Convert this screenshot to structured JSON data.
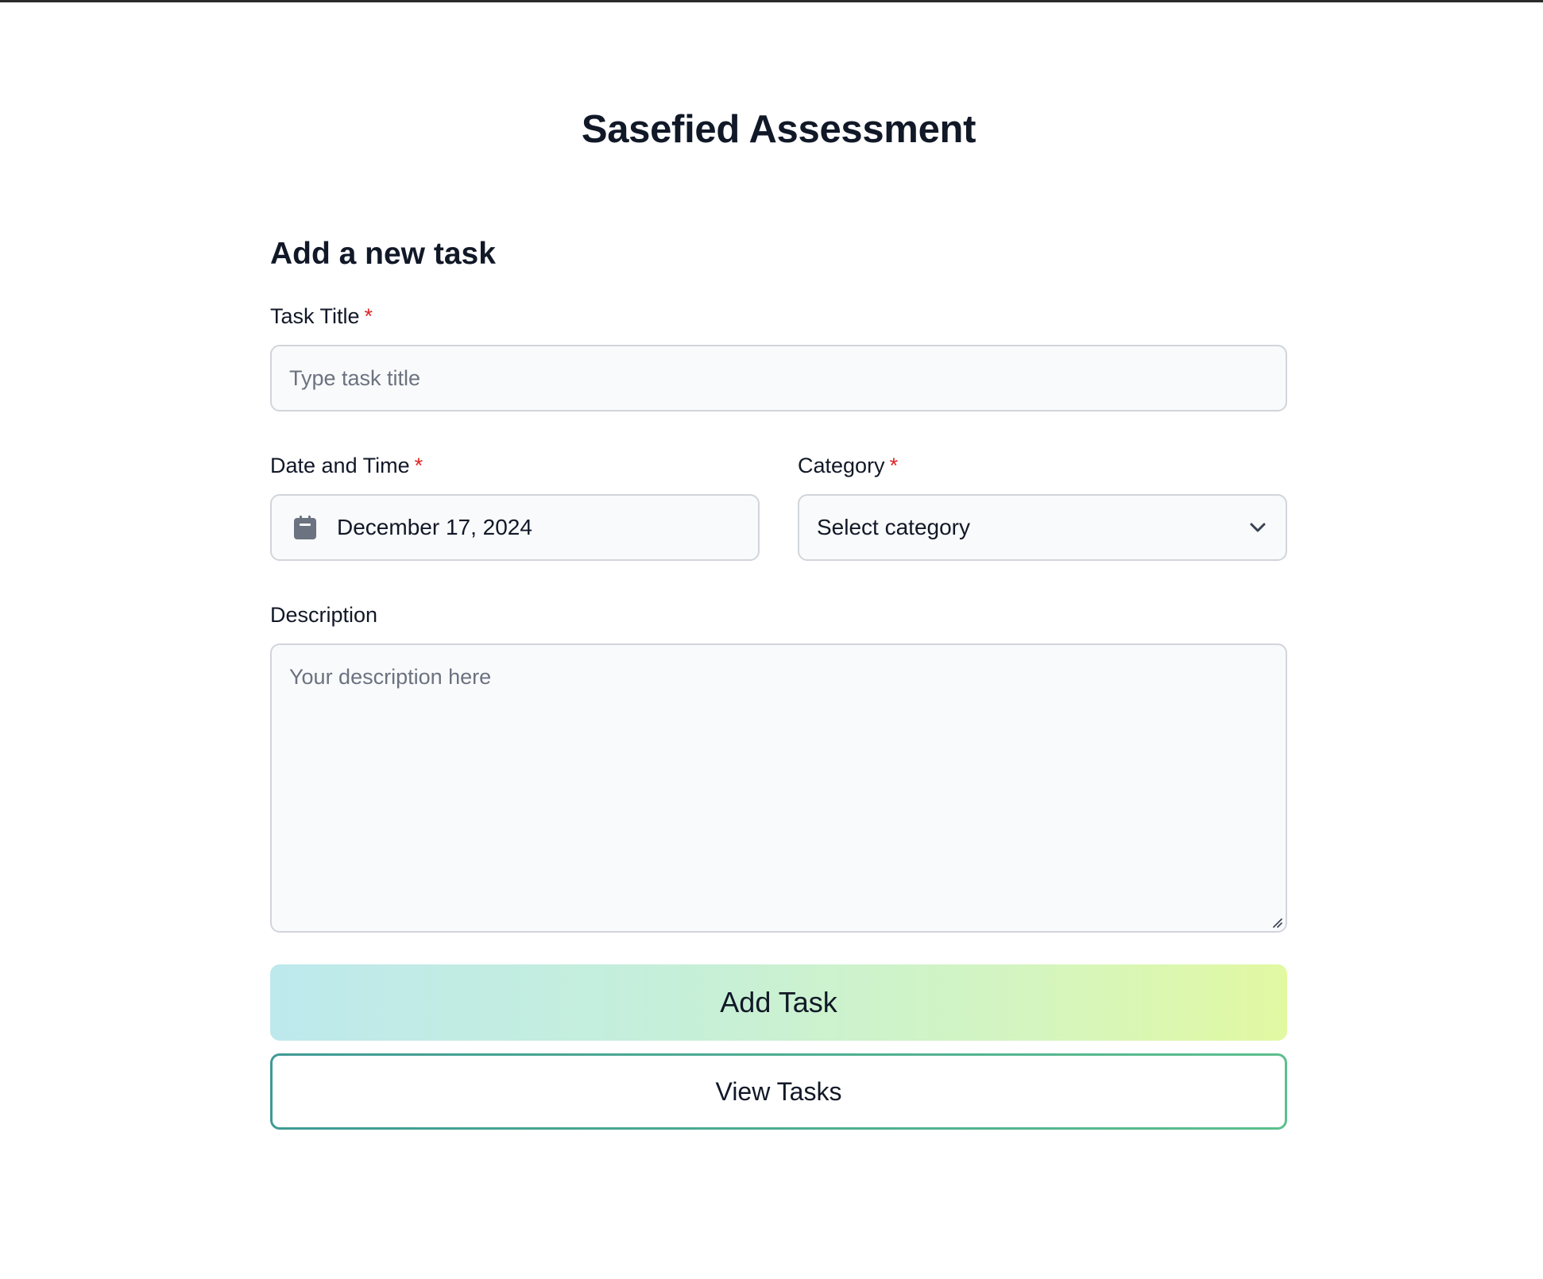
{
  "page": {
    "title": "Sasefied Assessment"
  },
  "form": {
    "heading": "Add a new task",
    "required_marker": "*",
    "task_title": {
      "label": "Task Title",
      "placeholder": "Type task title",
      "value": ""
    },
    "date_time": {
      "label": "Date and Time",
      "value": "December 17, 2024",
      "icon": "calendar-icon"
    },
    "category": {
      "label": "Category",
      "selected": "Select category",
      "icon": "chevron-down-icon"
    },
    "description": {
      "label": "Description",
      "placeholder": "Your description here",
      "value": ""
    },
    "add_button_label": "Add Task",
    "view_button_label": "View Tasks"
  },
  "colors": {
    "required": "#e02424",
    "field_bg": "#f9fafb",
    "field_border": "#d1d5db",
    "gradient_start": "#bde9ed",
    "gradient_end": "#e2f9a2",
    "outline_start": "#3f9a94",
    "outline_end": "#5cbf8e"
  }
}
